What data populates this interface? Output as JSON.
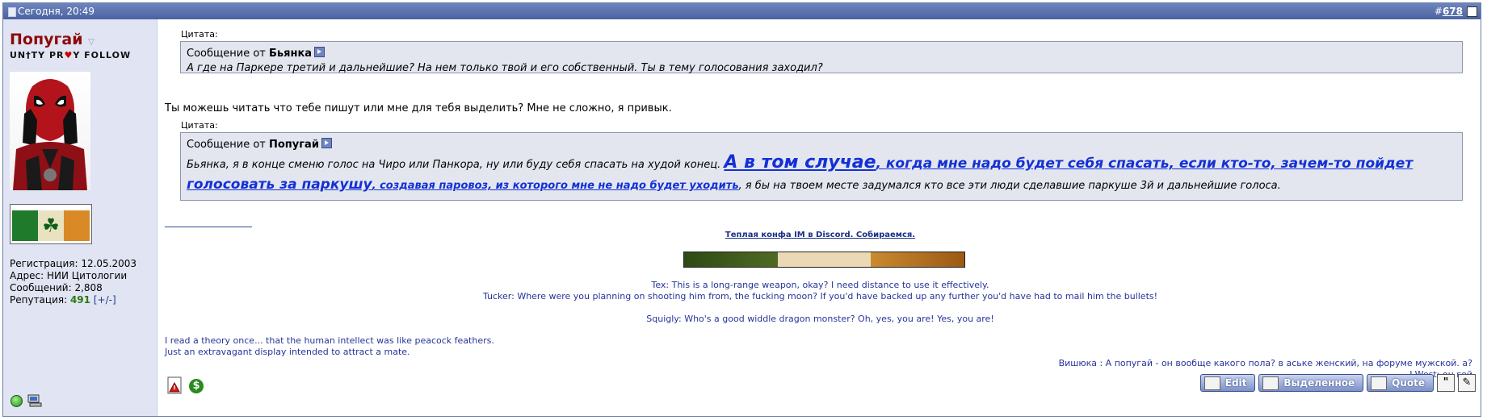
{
  "header": {
    "date": "Сегодня, 20:49",
    "post_hash": "#",
    "post_number": "678"
  },
  "user": {
    "name": "Попугай",
    "title_parts": [
      "UN",
      "†",
      "TY PR",
      "♥",
      "Y FOLLOW"
    ],
    "stats": {
      "reg_label": "Регистрация: ",
      "reg_value": "12.05.2003",
      "addr_label": "Адрес: ",
      "addr_value": "НИИ Цитологии",
      "msgs_label": "Сообщений: ",
      "msgs_value": "2,808",
      "rep_label": "Репутация: ",
      "rep_value": "491",
      "rep_link": "[+/-]"
    }
  },
  "quotes": [
    {
      "label": "Цитата:",
      "from_prefix": "Сообщение от ",
      "author": "Бьянка",
      "text": "А где на Паркере третий и дальнейшие? На нем только твой и его собственный. Ты в тему голосования заходил?"
    },
    {
      "label": "Цитата:",
      "from_prefix": "Сообщение от ",
      "author": "Попугай",
      "text_a": "Бьянка, я в конце сменю голос на Чиро или Панкора, ну или буду себя спасать на худой конец. ",
      "big1": "А в том случае",
      "big2a": ", когда мне надо будет себя спасать, если кто-то, зачем-то пойдет ",
      "big2b": "голосовать за паркушу",
      "big3": ", создавая паровоз, из которого мне не надо будет уходить",
      "text_b": ", я бы на твоем месте задумался кто все эти люди сделавшие паркуше 3й и дальнейшие голоса."
    }
  ],
  "reply_text": "Ты можешь читать что тебе пишут или мне для тебя выделить? Мне не сложно, я привык.",
  "signature": {
    "link": "Теплая конфа IM в Discord. Собираемся.",
    "line1": "Tex: This is a long-range weapon, okay? I need distance to use it effectively.",
    "line2": "Tucker: Where were you planning on shooting him from, the fucking moon? If you'd have backed up any further you'd have had to mail him the bullets!",
    "line3": "Squigly: Who's a good widdle dragon monster? Oh, yes, you are! Yes, you are!",
    "line4": "I read a theory once... that the human intellect was like peacock feathers.",
    "line5": "Just an extravagant display intended to attract a mate.",
    "line6": "Вишюка : А попугай - он вообще какого пола? в аське женский, на форуме мужской. а?",
    "line7": "J-West: он гей"
  },
  "buttons": {
    "edit": "Edit",
    "selected": "Выделенное",
    "quote": "Quote",
    "multi_glyph": "\"",
    "quick_glyph": "✎"
  },
  "colors": {
    "header": "#4a62a0",
    "sidebar": "#e1e4f2",
    "quote_bg": "#e3e6ef",
    "username": "#8c0a0a",
    "link_blue": "#1330d6",
    "sig_blue": "#26349a",
    "rep_green": "#2b7a12"
  },
  "icons": [
    "document-icon",
    "dropdown-triangle-icon",
    "clover-icon",
    "online-status-icon",
    "pc-icon",
    "goto-post-icon",
    "report-icon",
    "reputation-icon",
    "edit-icon",
    "quote-icon",
    "multiquote-icon",
    "quick-reply-icon"
  ]
}
